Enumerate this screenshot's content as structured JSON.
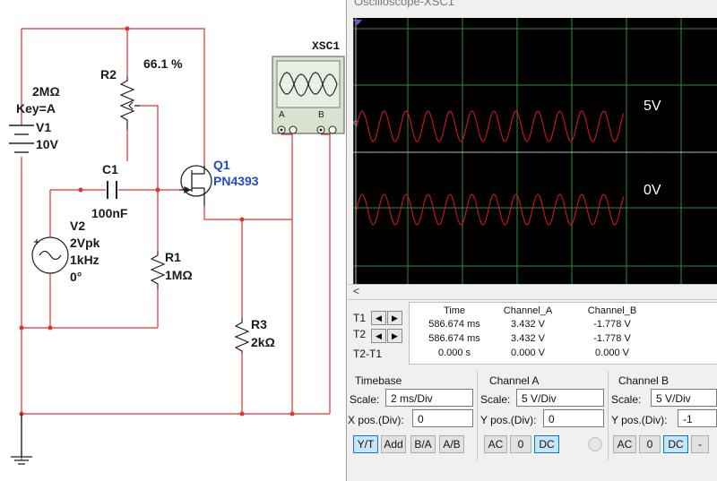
{
  "scope_window": {
    "title": "Oscilloscope-XSC1"
  },
  "circuit": {
    "r2": {
      "name": "R2",
      "value": "2MΩ",
      "key": "Key=A",
      "percent": "66.1 %"
    },
    "v1": {
      "name": "V1",
      "value": "10V"
    },
    "c1": {
      "name": "C1",
      "value": "100nF"
    },
    "q1": {
      "name": "Q1",
      "part": "PN4393"
    },
    "v2": {
      "name": "V2",
      "amplitude": "2Vpk",
      "frequency": "1kHz",
      "phase": "0°"
    },
    "r1": {
      "name": "R1",
      "value": "1MΩ"
    },
    "r3": {
      "name": "R3",
      "value": "2kΩ"
    },
    "xsc": {
      "name": "XSC1",
      "port_a": "A",
      "port_b": "B"
    }
  },
  "screen": {
    "trace_a_label": "5V",
    "trace_b_label": "0V",
    "trace_color": "#d01818"
  },
  "cursors": {
    "row_labels": [
      "T1",
      "T2",
      "T2-T1"
    ],
    "headers": [
      "Time",
      "Channel_A",
      "Channel_B"
    ],
    "rows": [
      [
        "586.674 ms",
        "3.432 V",
        "-1.778 V"
      ],
      [
        "586.674 ms",
        "3.432 V",
        "-1.778 V"
      ],
      [
        "0.000 s",
        "0.000 V",
        "0.000 V"
      ]
    ]
  },
  "timebase": {
    "title": "Timebase",
    "scale_label": "Scale:",
    "scale": "2 ms/Div",
    "xpos_label": "X pos.(Div):",
    "xpos": "0",
    "buttons": [
      "Y/T",
      "Add",
      "B/A",
      "A/B"
    ]
  },
  "channel_a": {
    "title": "Channel A",
    "scale_label": "Scale:",
    "scale": "5  V/Div",
    "ypos_label": "Y pos.(Div):",
    "ypos": "0",
    "buttons": [
      "AC",
      "0",
      "DC"
    ]
  },
  "channel_b": {
    "title": "Channel B",
    "scale_label": "Scale:",
    "scale": "5  V/Div",
    "ypos_label": "Y pos.(Div):",
    "ypos": "-1",
    "buttons": [
      "AC",
      "0",
      "DC",
      "-"
    ]
  },
  "colors": {
    "wire": "#e03030",
    "grid": "#3a8a3a",
    "screen_bg": "#000000"
  }
}
